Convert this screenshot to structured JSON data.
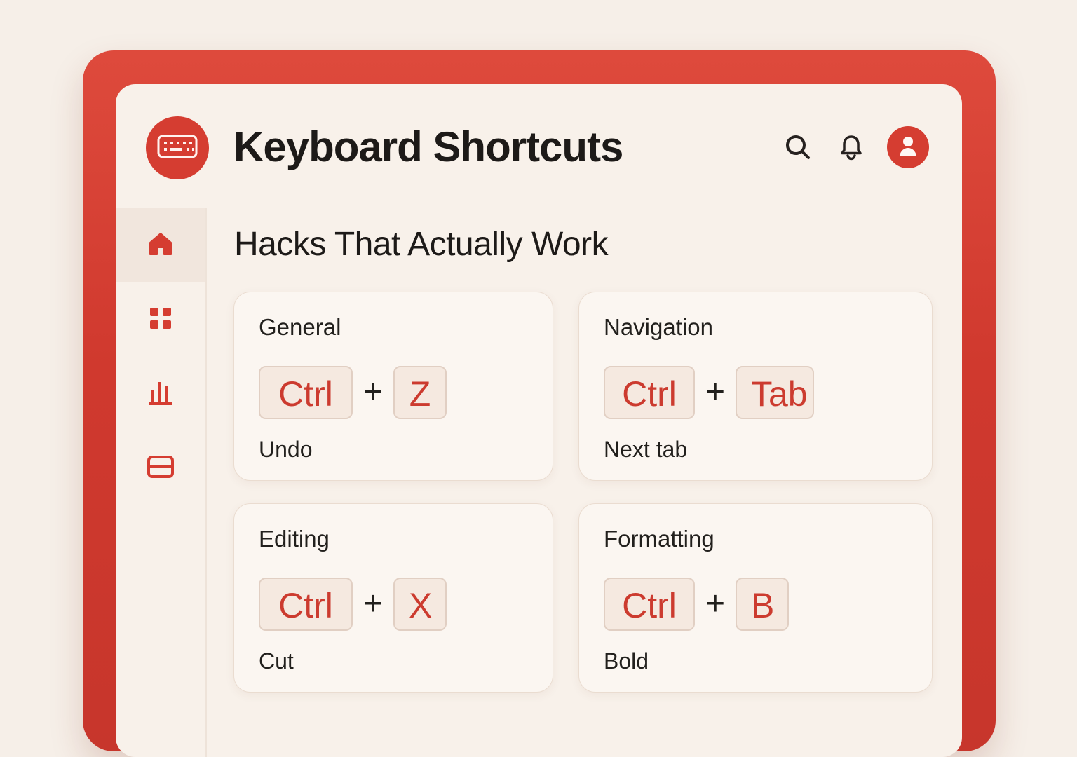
{
  "app": {
    "title": "Keyboard Shortcuts"
  },
  "header": {
    "icons": {
      "logo": "keyboard-icon",
      "search": "search-icon",
      "notifications": "bell-icon",
      "profile": "user-icon"
    }
  },
  "sidebar": {
    "items": [
      {
        "icon": "home-icon",
        "active": true
      },
      {
        "icon": "grid-icon",
        "active": false
      },
      {
        "icon": "bar-chart-icon",
        "active": false
      },
      {
        "icon": "card-icon",
        "active": false
      }
    ]
  },
  "content": {
    "title": "Hacks That Actually Work",
    "cards": [
      {
        "title": "General",
        "keys": [
          "Ctrl",
          "Z"
        ],
        "description": "Undo"
      },
      {
        "title": "Navigation",
        "keys": [
          "Ctrl",
          "Tab"
        ],
        "description": "Next tab"
      },
      {
        "title": "Editing",
        "keys": [
          "Ctrl",
          "X"
        ],
        "description": "Cut"
      },
      {
        "title": "Formatting",
        "keys": [
          "Ctrl",
          "B"
        ],
        "description": "Bold"
      }
    ],
    "plus_label": "+"
  },
  "theme": {
    "accent": "#d53d31",
    "frame": "#cf3b2f",
    "panel": "#f8f1ea",
    "page_background": "#f6efe8"
  }
}
